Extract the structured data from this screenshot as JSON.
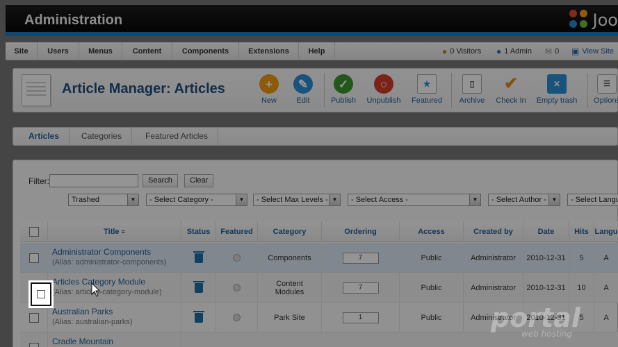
{
  "header": {
    "title": "Administration",
    "logo_text": "Joo"
  },
  "menu": {
    "items": [
      "Site",
      "Users",
      "Menus",
      "Content",
      "Components",
      "Extensions",
      "Help"
    ]
  },
  "status": {
    "visitors": "0 Visitors",
    "admin": "1 Admin",
    "messages": "0",
    "view_site": "View Site"
  },
  "page": {
    "title": "Article Manager: Articles"
  },
  "toolbar": [
    {
      "label": "New",
      "icon": "plus-icon",
      "color": "#f39c12"
    },
    {
      "label": "Edit",
      "icon": "pencil-icon",
      "color": "#2a8fd4"
    },
    {
      "label": "Publish",
      "icon": "check-icon",
      "color": "#3c9a2e"
    },
    {
      "label": "Unpublish",
      "icon": "circle-icon",
      "color": "#d63b2a"
    },
    {
      "label": "Featured",
      "icon": "star-page-icon",
      "color": "#ffffff"
    },
    {
      "label": "Archive",
      "icon": "archive-icon",
      "color": "#ffffff"
    },
    {
      "label": "Check In",
      "icon": "checkin-icon",
      "color": "#e98b1a"
    },
    {
      "label": "Empty trash",
      "icon": "trash-icon",
      "color": "#2a8fd4"
    },
    {
      "label": "Options",
      "icon": "options-icon",
      "color": "#ffffff"
    }
  ],
  "tabs": [
    "Articles",
    "Categories",
    "Featured Articles"
  ],
  "filter": {
    "label": "Filter:",
    "value": "",
    "search": "Search",
    "clear": "Clear",
    "selects": [
      "Trashed",
      "- Select Category -",
      "- Select Max Levels -",
      "- Select Access -",
      "- Select Author -",
      "- Select Langu"
    ]
  },
  "columns": [
    "Title",
    "Status",
    "Featured",
    "Category",
    "Ordering",
    "Access",
    "Created by",
    "Date",
    "Hits",
    "Langu"
  ],
  "rows": [
    {
      "title": "Administrator Components",
      "alias": "(Alias: administrator-components)",
      "category": "Components",
      "ordering": "7",
      "access": "Public",
      "created_by": "Administrator",
      "date": "2010-12-31",
      "hits": "5",
      "lang": "A"
    },
    {
      "title": "Articles Category Module",
      "alias": "(Alias: articles-category-module)",
      "category": "Content Modules",
      "ordering": "7",
      "access": "Public",
      "created_by": "Administrator",
      "date": "2010-12-31",
      "hits": "10",
      "lang": "A"
    },
    {
      "title": "Australian Parks",
      "alias": "(Alias: australian-parks)",
      "category": "Park Site",
      "ordering": "1",
      "access": "Public",
      "created_by": "Administrator",
      "date": "2010-12-31",
      "hits": "5",
      "lang": "A"
    },
    {
      "title": "Cradle Mountain",
      "alias": "",
      "category": "",
      "ordering": "",
      "access": "",
      "created_by": "",
      "date": "",
      "hits": "",
      "lang": ""
    }
  ],
  "watermark": {
    "brand": "portal",
    "tag": "web hosting"
  }
}
